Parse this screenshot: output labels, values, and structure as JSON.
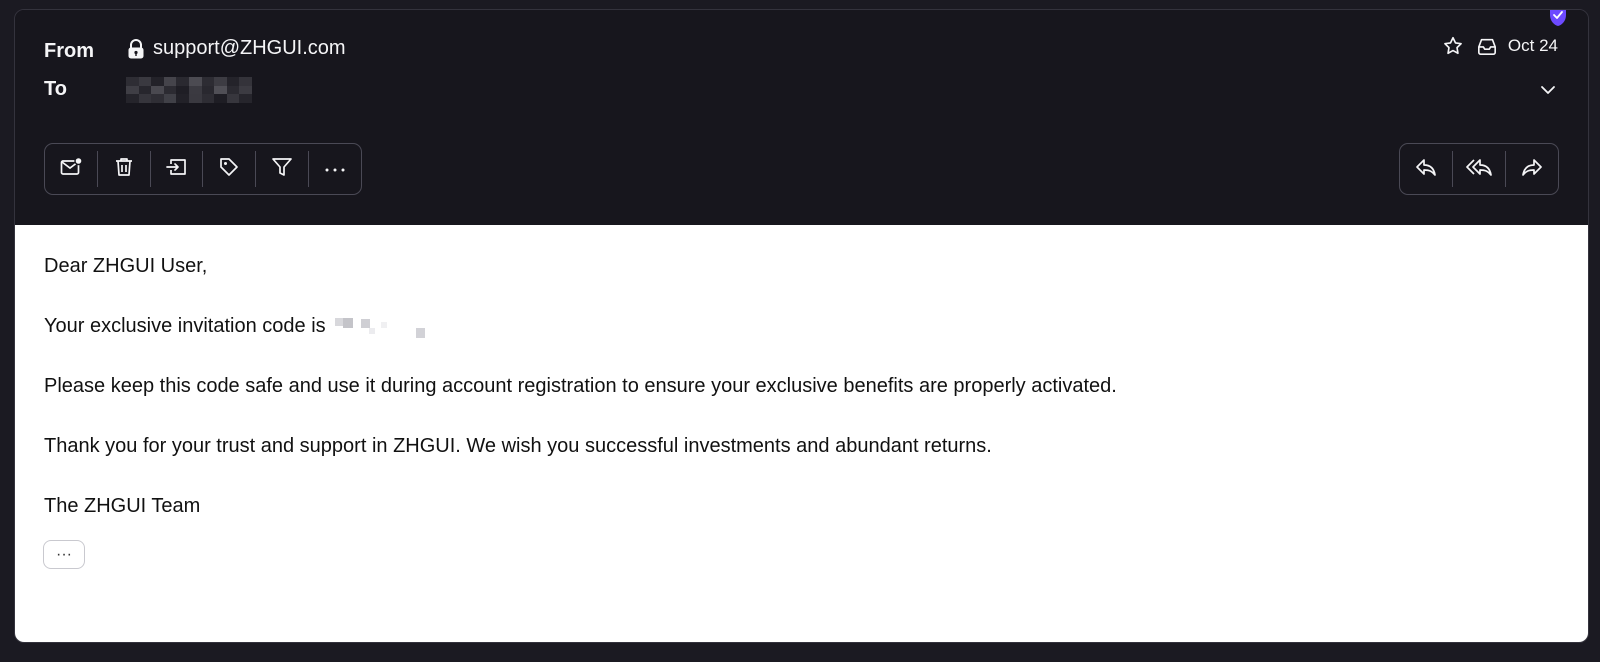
{
  "header": {
    "from_label": "From",
    "to_label": "To",
    "sender_email": "support@ZHGUI.com",
    "recipient": "",
    "date": "Oct 24"
  },
  "toolbar_left": [
    {
      "name": "mark-unread-button",
      "icon": "mail-dot-icon"
    },
    {
      "name": "delete-button",
      "icon": "trash-icon"
    },
    {
      "name": "move-button",
      "icon": "move-to-folder-icon"
    },
    {
      "name": "label-button",
      "icon": "tag-icon"
    },
    {
      "name": "filter-button",
      "icon": "filter-icon"
    },
    {
      "name": "more-actions-button",
      "icon": "ellipsis-icon"
    }
  ],
  "toolbar_right": [
    {
      "name": "reply-button",
      "icon": "reply-icon"
    },
    {
      "name": "reply-all-button",
      "icon": "reply-all-icon"
    },
    {
      "name": "forward-button",
      "icon": "forward-icon"
    }
  ],
  "body": {
    "greeting": "Dear ZHGUI User,",
    "code_line": "Your exclusive invitation code is",
    "paragraph_1": "Please keep this code safe and use it during account registration to ensure your exclusive benefits are properly activated.",
    "paragraph_2": "Thank you for your trust and support in ZHGUI. We wish you successful investments and abundant returns.",
    "signature": "The ZHGUI Team",
    "expand_label": "···"
  },
  "colors": {
    "header_bg": "#17161d",
    "body_bg": "#ffffff",
    "shield_badge": "#6d4aff"
  }
}
